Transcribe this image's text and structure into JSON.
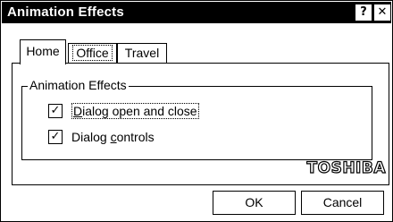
{
  "window": {
    "title": "Animation Effects",
    "help_glyph": "?",
    "close_glyph": "✕"
  },
  "tabs": [
    {
      "label": "Home",
      "active": true
    },
    {
      "label": "Office",
      "active": false
    },
    {
      "label": "Travel",
      "active": false
    }
  ],
  "group": {
    "legend": "Animation Effects",
    "options": [
      {
        "label_pre": "",
        "label_u": "D",
        "label_post": "ialog open and close",
        "checked": true
      },
      {
        "label_pre": "Dialog ",
        "label_u": "c",
        "label_post": "ontrols",
        "checked": true
      }
    ]
  },
  "brand": "TOSHIBA",
  "buttons": {
    "ok": "OK",
    "cancel": "Cancel"
  },
  "check_glyph": "✓",
  "colors": {
    "titlebar": "#000000",
    "background": "#ffffff"
  }
}
